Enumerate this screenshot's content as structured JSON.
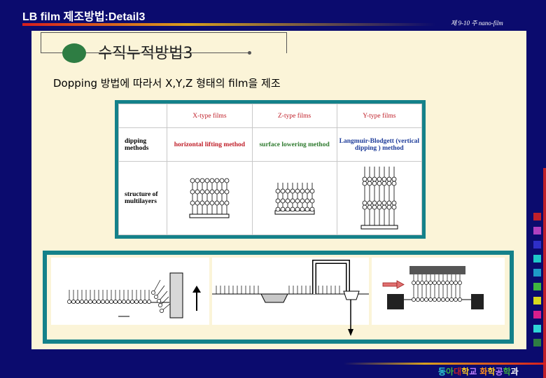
{
  "header": {
    "title": "LB film 제조방법:Detail3",
    "course_label": "제 9-10 주 nano-film"
  },
  "slide": {
    "heading": "수직누적방법3",
    "subheading": "Dopping 방법에 따라서 X,Y,Z 형태의 film을 제조"
  },
  "table": {
    "columns": [
      "X-type films",
      "Z-type films",
      "Y-type films"
    ],
    "rows": [
      {
        "label": "dipping methods",
        "cells": [
          "horizontal lifting method",
          "surface lowering method",
          "Langmuir-Blodgett (vertical dipping ) method"
        ]
      },
      {
        "label": "structure of multilayers",
        "cells": [
          "",
          "",
          ""
        ]
      }
    ]
  },
  "footer": {
    "parts": [
      {
        "text": "동",
        "color": "#2ed6d6"
      },
      {
        "text": "아",
        "color": "#3fb53f"
      },
      {
        "text": "대",
        "color": "#c0202a"
      },
      {
        "text": "학",
        "color": "#ffcc22"
      },
      {
        "text": "교",
        "color": "#c080ff"
      },
      {
        "text": " ",
        "color": "#ffffff"
      },
      {
        "text": "화",
        "color": "#ff8c1a"
      },
      {
        "text": "학",
        "color": "#ffcc22"
      },
      {
        "text": "공",
        "color": "#c080ff"
      },
      {
        "text": "학",
        "color": "#3fb53f"
      },
      {
        "text": "과",
        "color": "#ffffff"
      }
    ]
  },
  "decor_colors": [
    "#c0202a",
    "#b040c0",
    "#2e2ec8",
    "#1ec8c8",
    "#1e9ac8",
    "#3fb53f",
    "#d8d81e",
    "#d81e8c",
    "#2ed6d6",
    "#2e7d43"
  ]
}
